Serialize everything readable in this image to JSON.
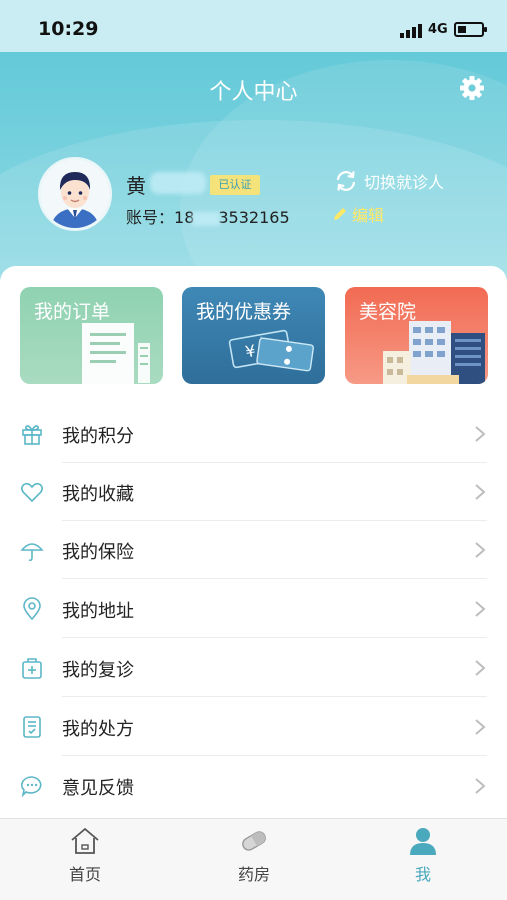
{
  "status_bar": {
    "time": "10:29",
    "network": "4G"
  },
  "header": {
    "title": "个人中心",
    "settings_icon": "gear-icon"
  },
  "profile": {
    "name": "黄",
    "verified_label": "已认证",
    "account_prefix": "账号：",
    "account_start": "18",
    "account_end": "3532165",
    "switch_label": "切换就诊人",
    "edit_label": "编辑"
  },
  "cards": [
    {
      "label": "我的订单",
      "icon": "document-icon",
      "color": "#8fd2b1"
    },
    {
      "label": "我的优惠券",
      "icon": "coupon-icon",
      "color": "#3f88b6"
    },
    {
      "label": "美容院",
      "icon": "building-icon",
      "color": "#f26a52"
    }
  ],
  "menu": [
    {
      "label": "我的积分",
      "icon": "gift-icon"
    },
    {
      "label": "我的收藏",
      "icon": "heart-icon"
    },
    {
      "label": "我的保险",
      "icon": "umbrella-icon"
    },
    {
      "label": "我的地址",
      "icon": "location-pin-icon"
    },
    {
      "label": "我的复诊",
      "icon": "medical-kit-icon"
    },
    {
      "label": "我的处方",
      "icon": "prescription-icon"
    },
    {
      "label": "意见反馈",
      "icon": "chat-bubble-icon"
    }
  ],
  "tabs": [
    {
      "label": "首页",
      "icon": "home-icon",
      "active": false
    },
    {
      "label": "药房",
      "icon": "pill-icon",
      "active": false
    },
    {
      "label": "我",
      "icon": "person-icon",
      "active": true
    }
  ],
  "colors": {
    "accent": "#4aa9bc",
    "header": "#5cc6d6",
    "badge": "#f4e27a",
    "edit": "#ffe866"
  }
}
